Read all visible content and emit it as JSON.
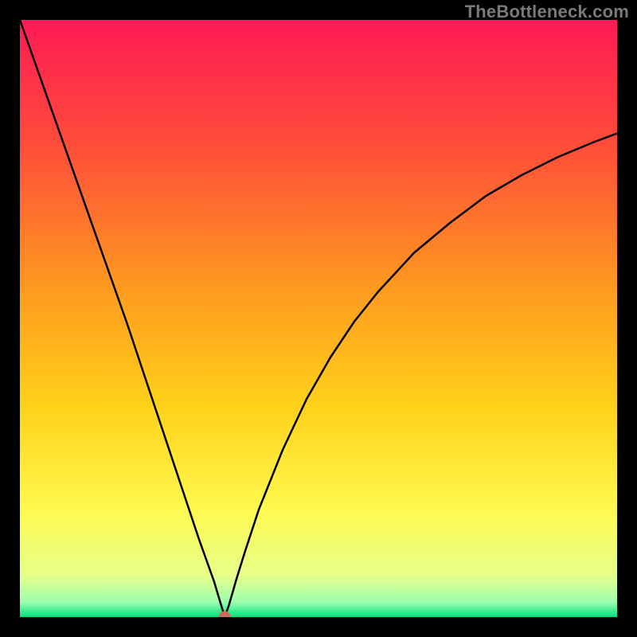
{
  "attribution": "TheBottleneck.com",
  "chart_data": {
    "type": "line",
    "title": "",
    "xlabel": "",
    "ylabel": "",
    "xlim": [
      0,
      100
    ],
    "ylim": [
      0,
      100
    ],
    "grid": false,
    "legend": false,
    "background_gradient": {
      "stops": [
        {
          "pos": 0.0,
          "color": "#ff1a55"
        },
        {
          "pos": 0.2,
          "color": "#ff4a3b"
        },
        {
          "pos": 0.45,
          "color": "#ff9a1f"
        },
        {
          "pos": 0.65,
          "color": "#ffd21a"
        },
        {
          "pos": 0.82,
          "color": "#fff94f"
        },
        {
          "pos": 0.93,
          "color": "#e7ff8a"
        },
        {
          "pos": 0.975,
          "color": "#9cffb0"
        },
        {
          "pos": 1.0,
          "color": "#00e07a"
        }
      ]
    },
    "marker": {
      "x": 34.3,
      "y": 0,
      "r": 7,
      "color": "#cc6a5c"
    },
    "series": [
      {
        "name": "curve",
        "x": [
          0,
          6,
          12,
          18,
          24,
          30,
          32.5,
          33.7,
          34.3,
          35.0,
          36.3,
          37.7,
          40,
          44,
          48,
          52,
          56,
          60,
          66,
          72,
          78,
          84,
          90,
          96,
          100
        ],
        "y": [
          100,
          83,
          66,
          49,
          31,
          13,
          6,
          2,
          0,
          2,
          6.5,
          11,
          18,
          28,
          36.5,
          43.5,
          49.5,
          54.5,
          61,
          66,
          70.5,
          74,
          77,
          79.5,
          81
        ]
      }
    ]
  }
}
